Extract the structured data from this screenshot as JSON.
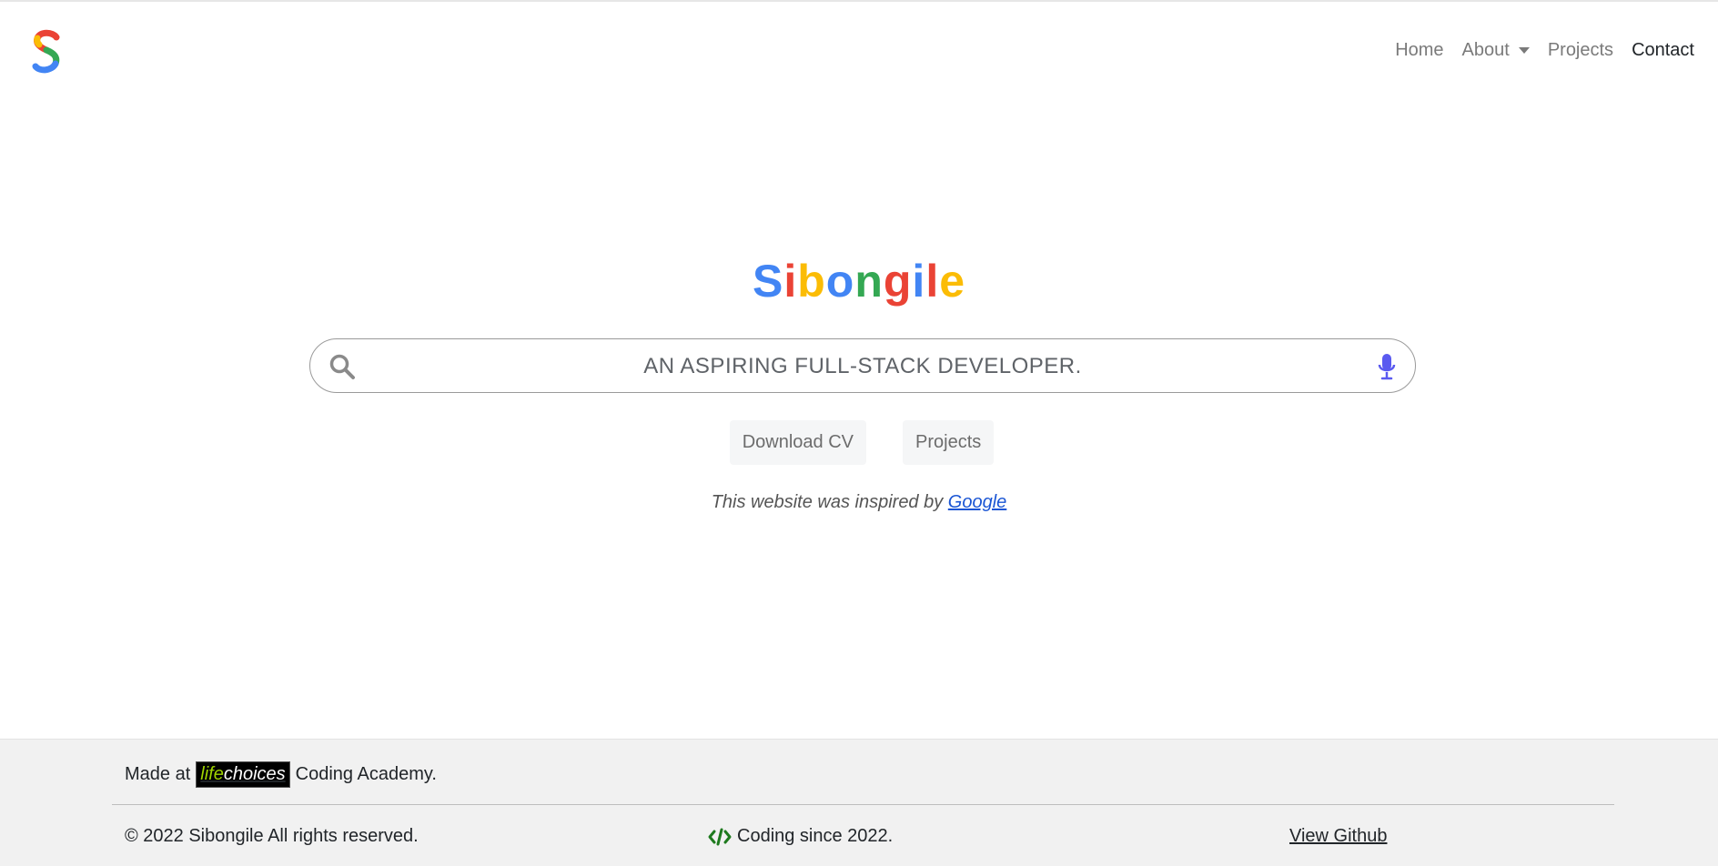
{
  "navbar": {
    "logo_icon": "colorful-s-logo-icon",
    "links": {
      "home": "Home",
      "about": "About",
      "projects": "Projects",
      "contact": "Contact"
    }
  },
  "hero": {
    "title_letters": [
      "S",
      "i",
      "b",
      "o",
      "n",
      "g",
      "i",
      "l",
      "e"
    ],
    "title_colors": [
      "#4285F4",
      "#EA4335",
      "#FBBC05",
      "#4285F4",
      "#34A853",
      "#EA4335",
      "#4285F4",
      "#EA4335",
      "#FBBC05"
    ],
    "search_text": "AN ASPIRING FULL-STACK DEVELOPER.",
    "search_icon": "search-icon",
    "mic_icon": "microphone-icon",
    "buttons": {
      "download_cv": "Download CV",
      "projects": "Projects"
    },
    "inspired_prefix": "This website was inspired by ",
    "inspired_link": "Google"
  },
  "footer": {
    "made_at": "Made at",
    "lc_life": "life",
    "lc_choices": "choices",
    "made_suffix": "Coding Academy.",
    "copyright": "© 2022 Sibongile All rights reserved.",
    "code_icon": "code-icon",
    "coding_since": "Coding since 2022.",
    "github": "View Github"
  },
  "colors": {
    "google_blue": "#4285F4",
    "google_red": "#EA4335",
    "google_yellow": "#FBBC05",
    "google_green": "#34A853",
    "link_blue": "#1a55d4",
    "footer_bg": "#f1f1f1",
    "code_icon_green": "#1e7a1e"
  }
}
